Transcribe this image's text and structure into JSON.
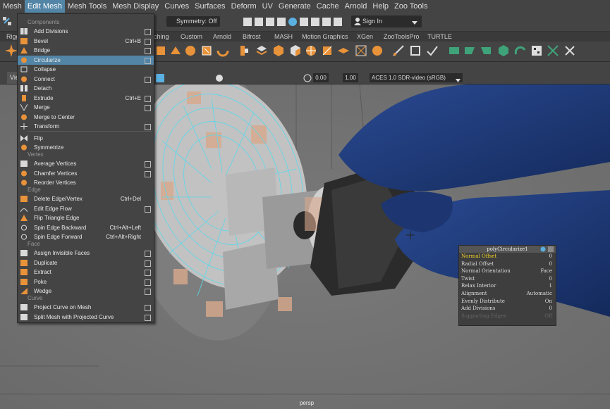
{
  "menubar": {
    "items": [
      "Mesh",
      "Edit Mesh",
      "Mesh Tools",
      "Mesh Display",
      "Curves",
      "Surfaces",
      "Deform",
      "UV",
      "Generate",
      "Cache",
      "Arnold",
      "Help",
      "Zoo Tools"
    ]
  },
  "status": {
    "symmetry": "Symmetry: Off",
    "sign_in": "Sign In"
  },
  "shelf_tabs": [
    "Rigg",
    "ching",
    "Custom",
    "Arnold",
    "Bifrost",
    "MASH",
    "Motion Graphics",
    "XGen",
    "ZooToolsPro",
    "TURTLE"
  ],
  "panel": {
    "view_tab": "Vie",
    "value1": "0.00",
    "value2": "1.00",
    "colorspace": "ACES 1.0 SDR-video (sRGB)"
  },
  "viewport": {
    "camera": "persp"
  },
  "dropdown": {
    "sections": {
      "components": "Components",
      "vertex": "Vertex",
      "edge": "Edge",
      "face": "Face",
      "curve": "Curve"
    },
    "items": [
      {
        "label": "Add Divisions",
        "shortcut": ""
      },
      {
        "label": "Bevel",
        "shortcut": "Ctrl+B"
      },
      {
        "label": "Bridge",
        "shortcut": ""
      },
      {
        "label": "Circularize",
        "shortcut": ""
      },
      {
        "label": "Collapse",
        "shortcut": ""
      },
      {
        "label": "Connect",
        "shortcut": ""
      },
      {
        "label": "Detach",
        "shortcut": ""
      },
      {
        "label": "Extrude",
        "shortcut": "Ctrl+E"
      },
      {
        "label": "Merge",
        "shortcut": ""
      },
      {
        "label": "Merge to Center",
        "shortcut": ""
      },
      {
        "label": "Transform",
        "shortcut": ""
      },
      {
        "label": "Flip",
        "shortcut": ""
      },
      {
        "label": "Symmetrize",
        "shortcut": ""
      },
      {
        "label": "Average Vertices",
        "shortcut": ""
      },
      {
        "label": "Chamfer Vertices",
        "shortcut": ""
      },
      {
        "label": "Reorder Vertices",
        "shortcut": ""
      },
      {
        "label": "Delete Edge/Vertex",
        "shortcut": "Ctrl+Del"
      },
      {
        "label": "Edit Edge Flow",
        "shortcut": ""
      },
      {
        "label": "Flip Triangle Edge",
        "shortcut": ""
      },
      {
        "label": "Spin Edge Backward",
        "shortcut": "Ctrl+Alt+Left"
      },
      {
        "label": "Spin Edge Forward",
        "shortcut": "Ctrl+Alt+Right"
      },
      {
        "label": "Assign Invisible Faces",
        "shortcut": ""
      },
      {
        "label": "Duplicate",
        "shortcut": ""
      },
      {
        "label": "Extract",
        "shortcut": ""
      },
      {
        "label": "Poke",
        "shortcut": ""
      },
      {
        "label": "Wedge",
        "shortcut": ""
      },
      {
        "label": "Project Curve on Mesh",
        "shortcut": ""
      },
      {
        "label": "Split Mesh with Projected Curve",
        "shortcut": ""
      }
    ]
  },
  "attr_editor": {
    "title": "polyCircularize1",
    "rows": [
      {
        "name": "Normal Offset",
        "value": "0"
      },
      {
        "name": "Radial Offset",
        "value": "0"
      },
      {
        "name": "Normal Orientation",
        "value": "Face"
      },
      {
        "name": "Twist",
        "value": "0"
      },
      {
        "name": "Relax Interior",
        "value": "1"
      },
      {
        "name": "Alignment",
        "value": "Automatic"
      },
      {
        "name": "Evenly Distribute",
        "value": "On"
      },
      {
        "name": "Add Divisions",
        "value": "0"
      },
      {
        "name": "Supporting Edges",
        "value": "Off"
      }
    ]
  },
  "colors": {
    "highlight": "#5285a6",
    "ui_bg": "#444444",
    "viewport_bg": "#727272",
    "wire": "#59d3e6",
    "mesh_blue": "#1e3a7a",
    "attr_selected": "#f2d028"
  }
}
